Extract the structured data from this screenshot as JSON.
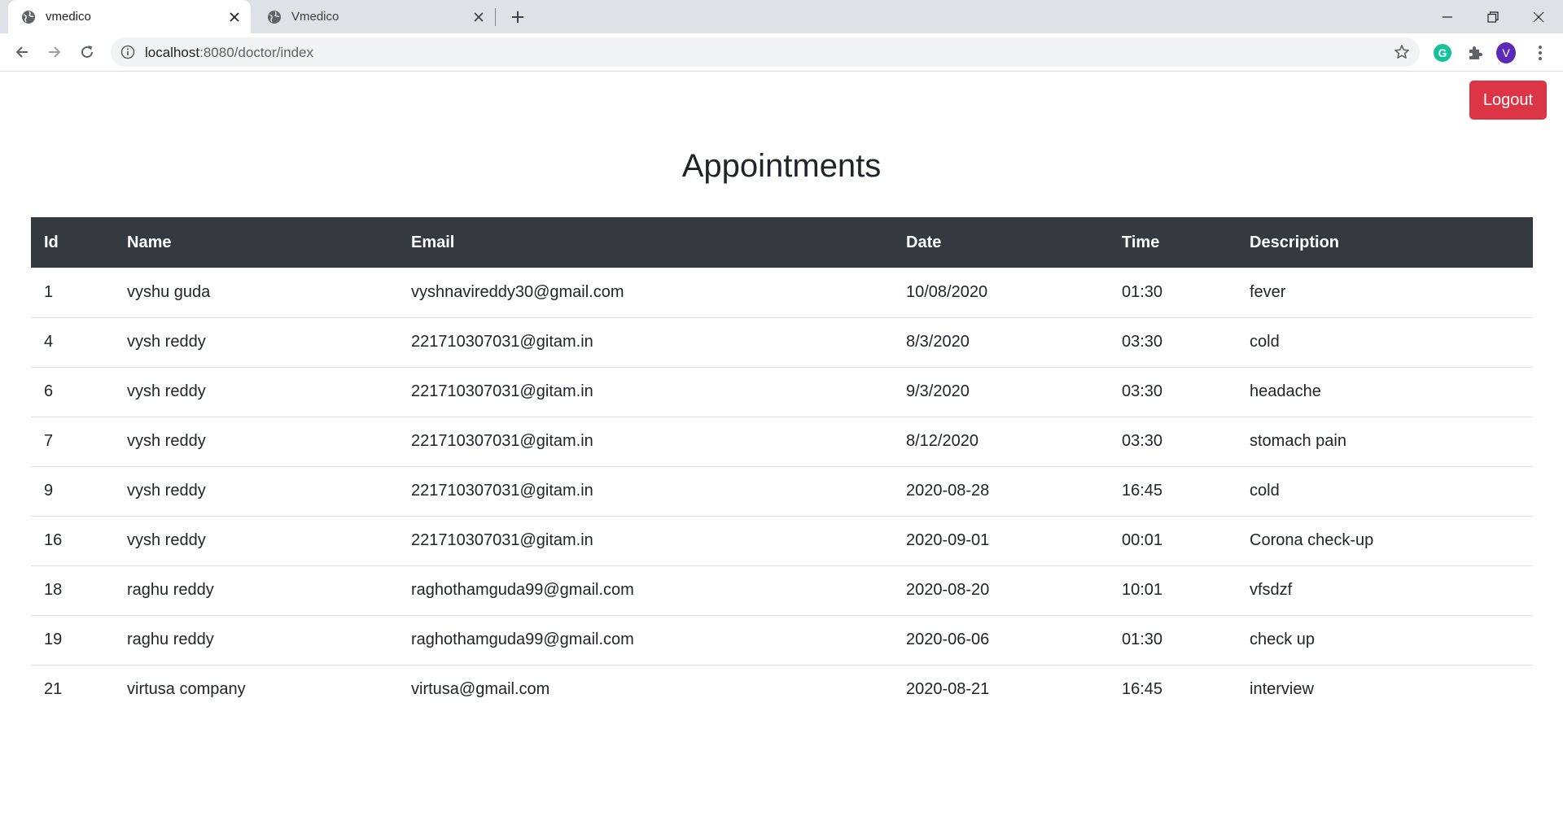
{
  "browser": {
    "tabs": [
      {
        "title": "vmedico",
        "active": true
      },
      {
        "title": "Vmedico",
        "active": false
      }
    ],
    "url_host": "localhost",
    "url_path": ":8080/doctor/index",
    "profile_initial": "V",
    "grammarly_letter": "G"
  },
  "header": {
    "logout_label": "Logout"
  },
  "main": {
    "title": "Appointments",
    "columns": [
      "Id",
      "Name",
      "Email",
      "Date",
      "Time",
      "Description"
    ],
    "rows": [
      [
        "1",
        "vyshu guda",
        "vyshnavireddy30@gmail.com",
        "10/08/2020",
        "01:30",
        "fever"
      ],
      [
        "4",
        "vysh reddy",
        "221710307031@gitam.in",
        "8/3/2020",
        "03:30",
        "cold"
      ],
      [
        "6",
        "vysh reddy",
        "221710307031@gitam.in",
        "9/3/2020",
        "03:30",
        "headache"
      ],
      [
        "7",
        "vysh reddy",
        "221710307031@gitam.in",
        "8/12/2020",
        "03:30",
        "stomach pain"
      ],
      [
        "9",
        "vysh reddy",
        "221710307031@gitam.in",
        "2020-08-28",
        "16:45",
        "cold"
      ],
      [
        "16",
        "vysh reddy",
        "221710307031@gitam.in",
        "2020-09-01",
        "00:01",
        "Corona check-up"
      ],
      [
        "18",
        "raghu reddy",
        "raghothamguda99@gmail.com",
        "2020-08-20",
        "10:01",
        "vfsdzf"
      ],
      [
        "19",
        "raghu reddy",
        "raghothamguda99@gmail.com",
        "2020-06-06",
        "01:30",
        "check up"
      ],
      [
        "21",
        "virtusa company",
        "virtusa@gmail.com",
        "2020-08-21",
        "16:45",
        "interview"
      ]
    ]
  },
  "colors": {
    "header_bg": "#343a40",
    "logout_bg": "#dc3545",
    "row_border": "#dee2e6"
  }
}
